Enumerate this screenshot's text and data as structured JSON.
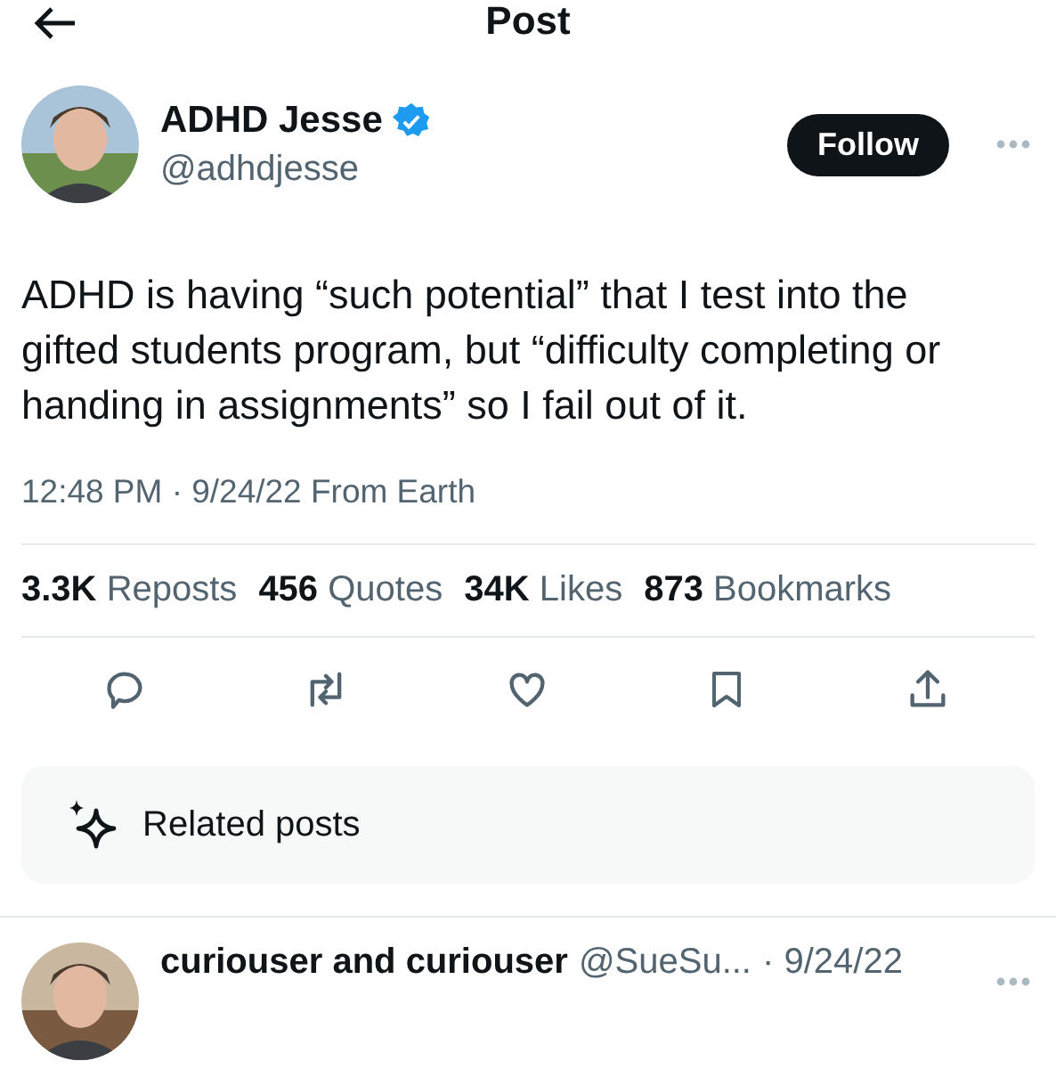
{
  "header": {
    "title": "Post"
  },
  "author": {
    "name": "ADHD Jesse",
    "verified": true,
    "handle": "@adhdjesse",
    "follow_label": "Follow"
  },
  "post": {
    "text": "ADHD is having “such potential” that I test into the gifted students program, but “difficulty completing or handing in assignments” so I fail out of it.",
    "meta": "12:48 PM · 9/24/22 From Earth"
  },
  "stats": [
    {
      "count": "3.3K",
      "label": "Reposts"
    },
    {
      "count": "456",
      "label": "Quotes"
    },
    {
      "count": "34K",
      "label": "Likes"
    },
    {
      "count": "873",
      "label": "Bookmarks"
    }
  ],
  "actions": [
    {
      "kind": "reply"
    },
    {
      "kind": "repost"
    },
    {
      "kind": "like"
    },
    {
      "kind": "bookmark"
    },
    {
      "kind": "share"
    }
  ],
  "related": {
    "label": "Related posts"
  },
  "replies": [
    {
      "name": "curiouser and curiouser",
      "handle": "@SueSu...",
      "date": "· 9/24/22"
    }
  ]
}
